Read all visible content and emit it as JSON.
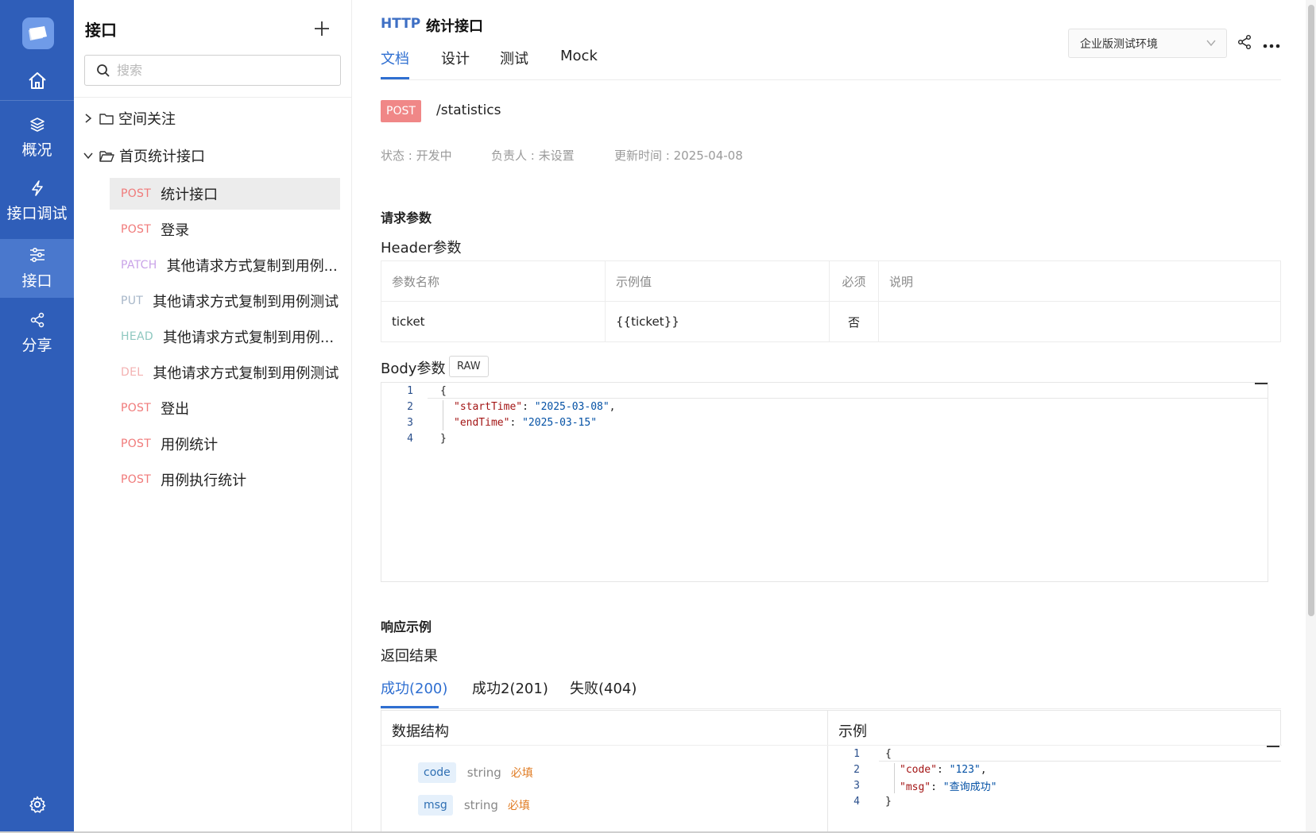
{
  "nav": {
    "items": [
      {
        "label": "概况",
        "icon": "layers-icon"
      },
      {
        "label": "接口调试",
        "icon": "lightning-icon"
      },
      {
        "label": "接口",
        "icon": "sliders-icon",
        "active": true
      },
      {
        "label": "分享",
        "icon": "share-icon"
      }
    ],
    "accent": "#2f5eb9"
  },
  "sidebar": {
    "title": "接口",
    "search_placeholder": "搜索",
    "folders": [
      {
        "label": "空间关注",
        "expanded": false
      },
      {
        "label": "首页统计接口",
        "expanded": true
      }
    ],
    "items": [
      {
        "method": "POST",
        "name": "统计接口",
        "selected": true
      },
      {
        "method": "POST",
        "name": "登录"
      },
      {
        "method": "PATCH",
        "name": "其他请求方式复制到用例..."
      },
      {
        "method": "PUT",
        "name": "其他请求方式复制到用例测试"
      },
      {
        "method": "HEAD",
        "name": "其他请求方式复制到用例..."
      },
      {
        "method": "DEL",
        "name": "其他请求方式复制到用例测试"
      },
      {
        "method": "POST",
        "name": "登出"
      },
      {
        "method": "POST",
        "name": "用例统计"
      },
      {
        "method": "POST",
        "name": "用例执行统计"
      }
    ]
  },
  "header": {
    "protocol": "HTTP",
    "title": "统计接口",
    "tabs": [
      "文档",
      "设计",
      "测试",
      "Mock"
    ],
    "active_tab": "文档",
    "environment": "企业版测试环境"
  },
  "api": {
    "method": "POST",
    "path": "/statistics",
    "status": "状态 : 开发中",
    "owner": "负责人 : 未设置",
    "updated": "更新时间 : 2025-04-08"
  },
  "request": {
    "section_title": "请求参数",
    "header_title": "Header参数",
    "columns": [
      "参数名称",
      "示例值",
      "必须",
      "说明"
    ],
    "rows": [
      {
        "name": "ticket",
        "example": "{{ticket}}",
        "required": "否",
        "desc": ""
      }
    ],
    "body_title": "Body参数",
    "body_type": "RAW",
    "body_lines": [
      {
        "no": "1",
        "key": "",
        "value": "",
        "text": "{"
      },
      {
        "no": "2",
        "key": "\"startTime\"",
        "value": "\"2025-03-08\"",
        "sep": ",",
        "text": ""
      },
      {
        "no": "3",
        "key": "\"endTime\"",
        "value": "\"2025-03-15\"",
        "sep": "",
        "text": ""
      },
      {
        "no": "4",
        "key": "",
        "value": "",
        "text": "}"
      }
    ]
  },
  "response": {
    "section_title": "响应示例",
    "sub_title": "返回结果",
    "tabs": [
      "成功(200)",
      "成功2(201)",
      "失败(404)"
    ],
    "active_tab": "成功(200)",
    "structure_title": "数据结构",
    "example_title": "示例",
    "fields": [
      {
        "name": "code",
        "type": "string",
        "required": "必填"
      },
      {
        "name": "msg",
        "type": "string",
        "required": "必填"
      }
    ],
    "example_lines": [
      {
        "no": "1",
        "key": "",
        "value": "",
        "text": "{"
      },
      {
        "no": "2",
        "key": "\"code\"",
        "value": "\"123\"",
        "sep": ",",
        "text": ""
      },
      {
        "no": "3",
        "key": "\"msg\"",
        "value": "\"查询成功\"",
        "sep": "",
        "text": ""
      },
      {
        "no": "4",
        "key": "",
        "value": "",
        "text": "}"
      }
    ]
  }
}
